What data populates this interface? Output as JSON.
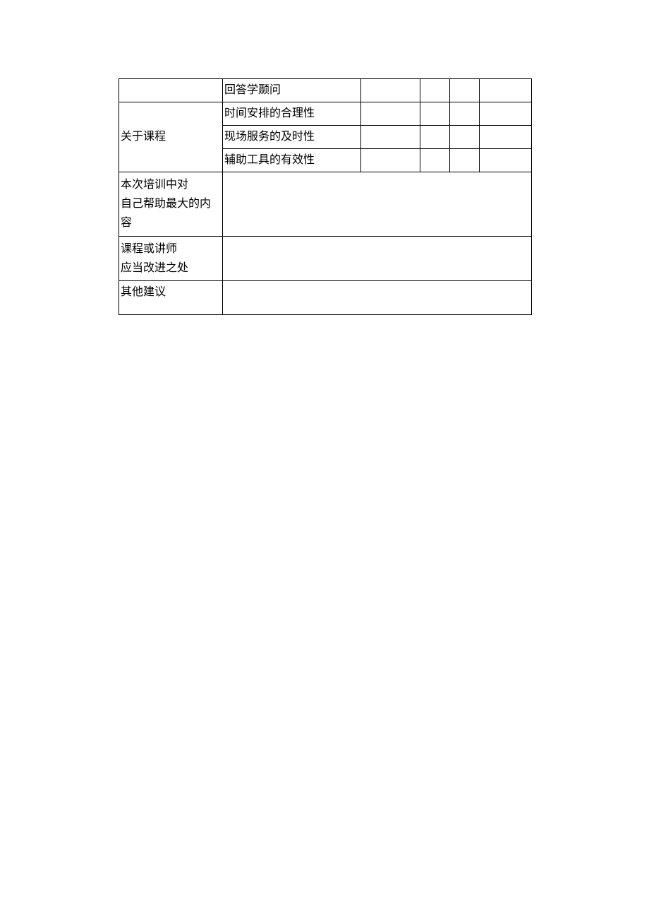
{
  "rows": {
    "r1_item": "回答学颞问",
    "r2_cat": "关于课程",
    "r2_item": "时间安排的合理性",
    "r3_item": "现场服务的及时性",
    "r4_item": "辅助工具的有效性",
    "r5_cat_line1": "本次培训中对",
    "r5_cat_line2": "自己帮助最大的内容",
    "r6_cat_line1": "课程或讲师",
    "r6_cat_line2": "应当改进之处",
    "r7_cat": "其他建议"
  }
}
